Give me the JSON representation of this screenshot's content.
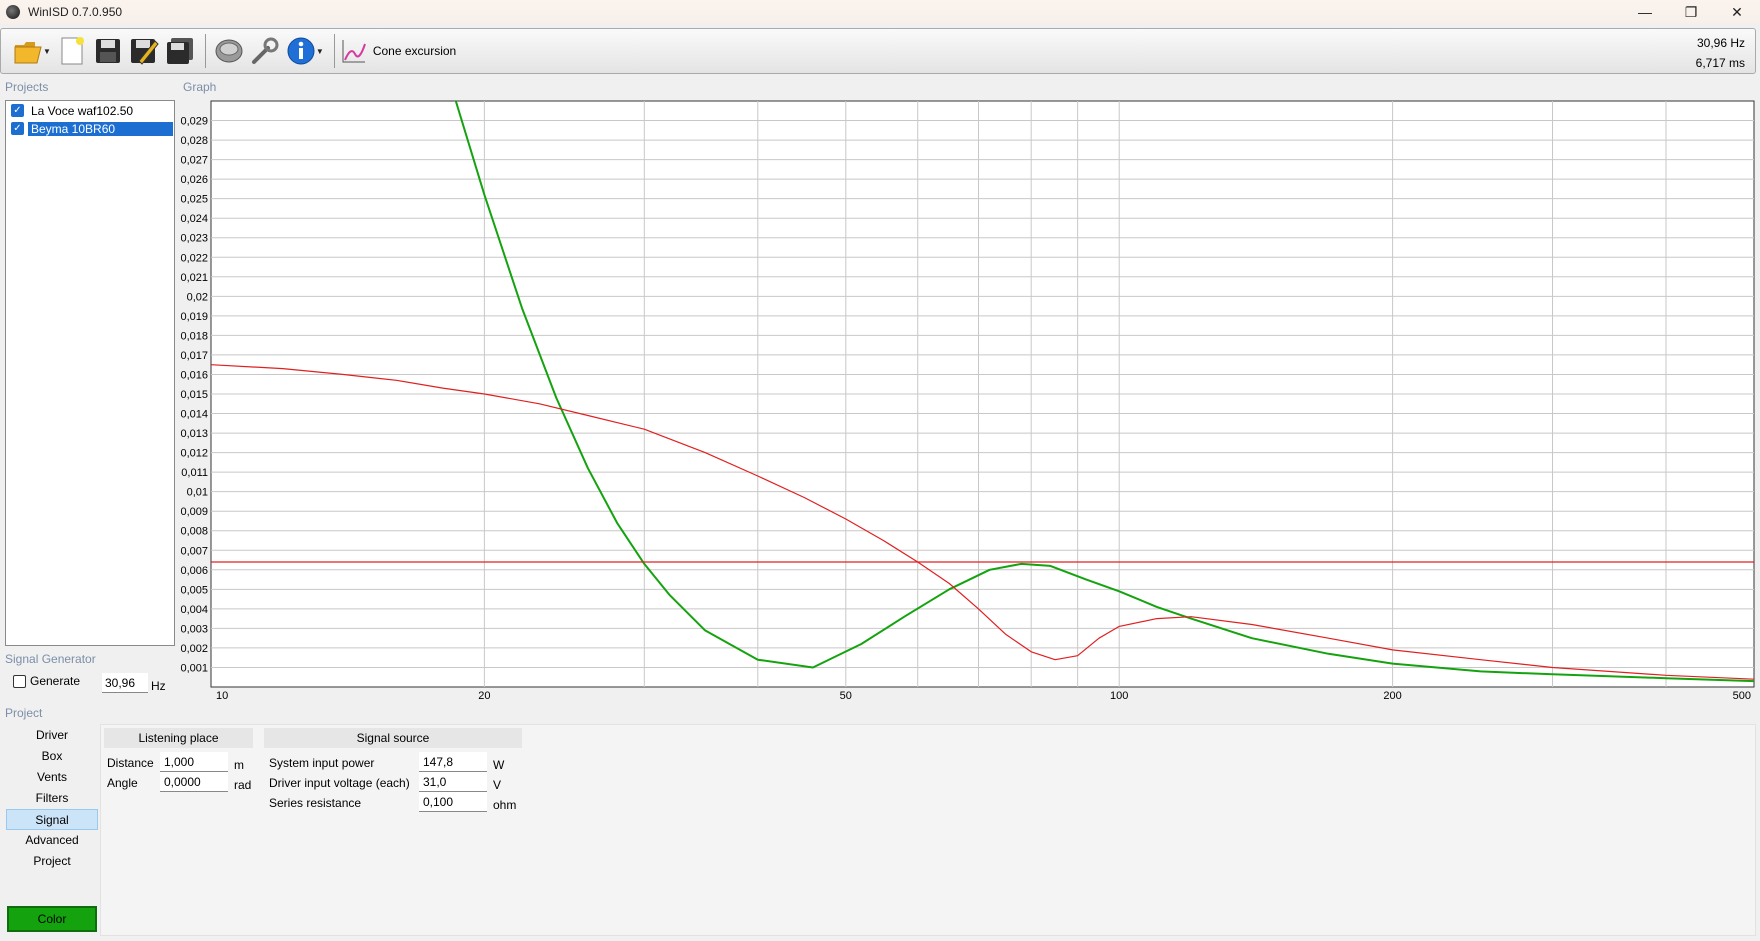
{
  "window": {
    "title": "WinISD 0.7.0.950",
    "minimize": "—",
    "restore": "❐",
    "close": "✕"
  },
  "toolbar": {
    "graph_type_label": "Cone excursion",
    "readout_freq": "30,96 Hz",
    "readout_time": "6,717 ms"
  },
  "sections": {
    "projects": "Projects",
    "graph": "Graph",
    "signal_generator": "Signal Generator",
    "project": "Project"
  },
  "projects": [
    {
      "name": "La Voce waf102.50",
      "checked": true,
      "selected": false
    },
    {
      "name": "Beyma 10BR60",
      "checked": true,
      "selected": true
    }
  ],
  "signal_generator": {
    "generate_label": "Generate",
    "frequency": "30,96",
    "unit": "Hz"
  },
  "nav": {
    "items": [
      "Driver",
      "Box",
      "Vents",
      "Filters",
      "Signal",
      "Advanced",
      "Project"
    ],
    "active": "Signal",
    "color_button": "Color"
  },
  "listening_place": {
    "header": "Listening place",
    "distance_label": "Distance",
    "distance_value": "1,000",
    "distance_unit": "m",
    "angle_label": "Angle",
    "angle_value": "0,0000",
    "angle_unit": "rad"
  },
  "signal_source": {
    "header": "Signal source",
    "power_label": "System input power",
    "power_value": "147,8",
    "power_unit": "W",
    "voltage_label": "Driver input voltage (each)",
    "voltage_value": "31,0",
    "voltage_unit": "V",
    "resistance_label": "Series resistance",
    "resistance_value": "0,100",
    "resistance_unit": "ohm"
  },
  "colors": {
    "green_series": "#14a30f",
    "red_series": "#e02020",
    "selection": "#1c6fd1"
  },
  "chart_data": {
    "type": "line",
    "x_scale": "log",
    "xlim": [
      10,
      500
    ],
    "ylim": [
      0,
      0.03
    ],
    "grid": true,
    "x_tick_labels": [
      {
        "value": 10,
        "label": "10"
      },
      {
        "value": 20,
        "label": "20"
      },
      {
        "value": 50,
        "label": "50"
      },
      {
        "value": 100,
        "label": "100"
      },
      {
        "value": 200,
        "label": "200"
      },
      {
        "value": 500,
        "label": "500"
      }
    ],
    "x_grid": [
      20,
      30,
      40,
      50,
      60,
      70,
      80,
      90,
      100,
      200,
      300,
      400
    ],
    "y_tick_labels": [
      "0,001",
      "0,002",
      "0,003",
      "0,004",
      "0,005",
      "0,006",
      "0,007",
      "0,008",
      "0,009",
      "0,01",
      "0,011",
      "0,012",
      "0,013",
      "0,014",
      "0,015",
      "0,016",
      "0,017",
      "0,018",
      "0,019",
      "0,02",
      "0,021",
      "0,022",
      "0,023",
      "0,024",
      "0,025",
      "0,026",
      "0,027",
      "0,028",
      "0,029"
    ],
    "series": [
      {
        "color": "#14a30f",
        "points": [
          [
            18.6,
            0.03
          ],
          [
            20,
            0.0252
          ],
          [
            22,
            0.0194
          ],
          [
            24,
            0.0148
          ],
          [
            26,
            0.0112
          ],
          [
            28,
            0.0084
          ],
          [
            30,
            0.0063
          ],
          [
            32,
            0.0047
          ],
          [
            35,
            0.0029
          ],
          [
            40,
            0.0014
          ],
          [
            46,
            0.001
          ],
          [
            52,
            0.0022
          ],
          [
            58,
            0.0036
          ],
          [
            65,
            0.005
          ],
          [
            72,
            0.006
          ],
          [
            78,
            0.0063
          ],
          [
            84,
            0.0062
          ],
          [
            92,
            0.0055
          ],
          [
            100,
            0.0049
          ],
          [
            110,
            0.0041
          ],
          [
            120,
            0.0035
          ],
          [
            140,
            0.0025
          ],
          [
            170,
            0.0017
          ],
          [
            200,
            0.0012
          ],
          [
            250,
            0.0008
          ],
          [
            300,
            0.00065
          ],
          [
            400,
            0.00045
          ],
          [
            500,
            0.0003
          ]
        ]
      },
      {
        "color": "#e02020",
        "points": [
          [
            10,
            0.0165
          ],
          [
            12,
            0.0163
          ],
          [
            14,
            0.016
          ],
          [
            16,
            0.0157
          ],
          [
            18,
            0.0153
          ],
          [
            20,
            0.015
          ],
          [
            23,
            0.0145
          ],
          [
            26,
            0.0139
          ],
          [
            30,
            0.0132
          ],
          [
            35,
            0.012
          ],
          [
            40,
            0.0108
          ],
          [
            45,
            0.0097
          ],
          [
            50,
            0.0086
          ],
          [
            55,
            0.0075
          ],
          [
            60,
            0.0064
          ],
          [
            65,
            0.0053
          ],
          [
            70,
            0.004
          ],
          [
            75,
            0.0027
          ],
          [
            80,
            0.0018
          ],
          [
            85,
            0.0014
          ],
          [
            90,
            0.0016
          ],
          [
            95,
            0.0025
          ],
          [
            100,
            0.0031
          ],
          [
            110,
            0.0035
          ],
          [
            120,
            0.0036
          ],
          [
            140,
            0.0032
          ],
          [
            170,
            0.0025
          ],
          [
            200,
            0.0019
          ],
          [
            250,
            0.0014
          ],
          [
            300,
            0.001
          ],
          [
            400,
            0.0006
          ],
          [
            500,
            0.0004
          ]
        ]
      },
      {
        "color": "#e02020",
        "points": [
          [
            10,
            0.0064
          ],
          [
            500,
            0.0064
          ]
        ]
      }
    ]
  }
}
